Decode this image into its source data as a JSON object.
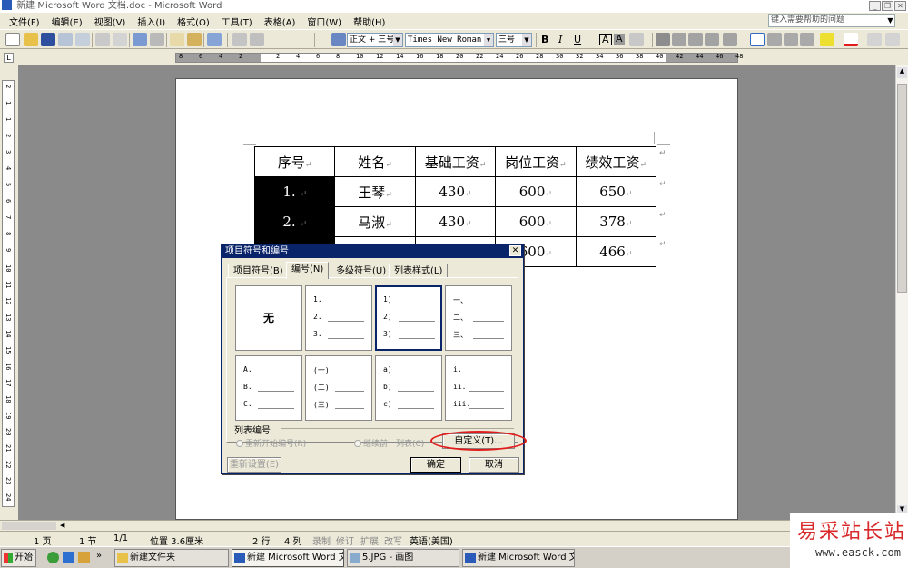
{
  "window": {
    "title": "新建 Microsoft Word 文档.doc - Microsoft Word",
    "min": "_",
    "restore": "❐",
    "close": "✕"
  },
  "menu": {
    "items": [
      "文件(F)",
      "编辑(E)",
      "视图(V)",
      "插入(I)",
      "格式(O)",
      "工具(T)",
      "表格(A)",
      "窗口(W)",
      "帮助(H)"
    ],
    "help_placeholder": "键入需要帮助的问题"
  },
  "toolbar": {
    "style": "正文 + 三号",
    "font": "Times New Roman",
    "size": "三号",
    "bold": "B",
    "italic": "I",
    "underline": "U",
    "char_border": "A",
    "char_shade": "A"
  },
  "ruler": {
    "numbers": [
      "8",
      "6",
      "4",
      "2",
      "2",
      "4",
      "6",
      "8",
      "10",
      "12",
      "14",
      "16",
      "18",
      "20",
      "22",
      "24",
      "26",
      "28",
      "30",
      "32",
      "34",
      "36",
      "38",
      "40",
      "42",
      "44",
      "46",
      "48"
    ]
  },
  "vruler": {
    "numbers": [
      "2",
      "1",
      "1",
      "2",
      "3",
      "4",
      "5",
      "6",
      "7",
      "8",
      "9",
      "10",
      "11",
      "12",
      "13",
      "14",
      "15",
      "16",
      "17",
      "18",
      "19",
      "20",
      "21",
      "22",
      "23",
      "24"
    ]
  },
  "table": {
    "headers": [
      "序号",
      "姓名",
      "基础工资",
      "岗位工资",
      "绩效工资"
    ],
    "rows": [
      [
        "1.",
        "王琴",
        "430",
        "600",
        "650"
      ],
      [
        "2.",
        "马淑",
        "430",
        "600",
        "378"
      ],
      [
        "",
        "",
        "",
        "600",
        "466"
      ]
    ]
  },
  "dialog": {
    "title": "项目符号和编号",
    "tabs": [
      "项目符号(B)",
      "编号(N)",
      "多级符号(U)",
      "列表样式(L)"
    ],
    "none_label": "无",
    "options": [
      [
        "1.",
        "2.",
        "3."
      ],
      [
        "1)",
        "2)",
        "3)"
      ],
      [
        "一、",
        "二、",
        "三、"
      ],
      [
        "A.",
        "B.",
        "C."
      ],
      [
        "(一)",
        "(二)",
        "(三)"
      ],
      [
        "a)",
        "b)",
        "c)"
      ],
      [
        "i.",
        "ii.",
        "iii."
      ]
    ],
    "group_label": "列表编号",
    "restart": "重新开始编号(R)",
    "continue": "继续前一列表(C)",
    "customize": "自定义(T)...",
    "reset": "重新设置(E)",
    "ok": "确定",
    "cancel": "取消"
  },
  "status": {
    "page": "1 页",
    "section": "1 节",
    "pages": "1/1",
    "position": "位置 3.6厘米",
    "line": "2 行",
    "col": "4 列",
    "rec": "录制",
    "trk": "修订",
    "ext": "扩展",
    "ovr": "改写",
    "lang": "英语(美国)"
  },
  "taskbar": {
    "start": "开始",
    "tasks": [
      "新建文件夹",
      "新建 Microsoft Word 文...",
      "5.JPG - 画图",
      "新建 Microsoft Word 文..."
    ]
  },
  "watermark": {
    "cn": "易采站长站",
    "url": "www.easck.com"
  },
  "colors": {
    "title_bar": "#0a246a",
    "highlight": "#e21b1b",
    "watermark": "#d8282a"
  }
}
